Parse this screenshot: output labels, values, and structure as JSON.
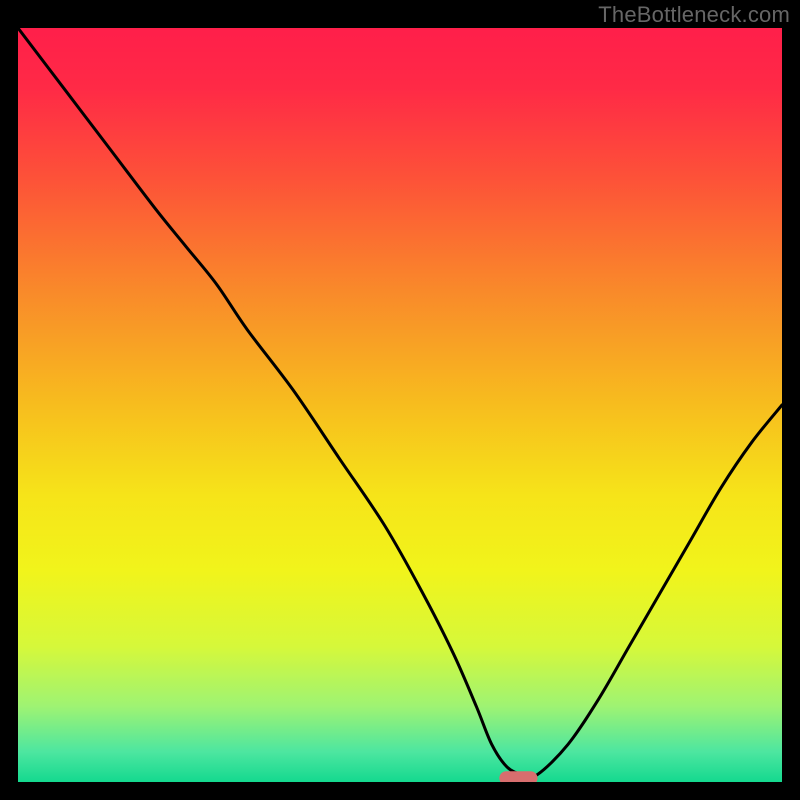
{
  "watermark": "TheBottleneck.com",
  "colors": {
    "frame": "#000000",
    "curve": "#000000",
    "marker_fill": "#d86e6e",
    "gradient_stops": [
      {
        "offset": 0.0,
        "color": "#ff1f4a"
      },
      {
        "offset": 0.08,
        "color": "#ff2a46"
      },
      {
        "offset": 0.2,
        "color": "#fd5238"
      },
      {
        "offset": 0.35,
        "color": "#f98a2a"
      },
      {
        "offset": 0.5,
        "color": "#f7bd1e"
      },
      {
        "offset": 0.62,
        "color": "#f6e419"
      },
      {
        "offset": 0.72,
        "color": "#f1f41b"
      },
      {
        "offset": 0.82,
        "color": "#d6f83a"
      },
      {
        "offset": 0.9,
        "color": "#9ef373"
      },
      {
        "offset": 0.96,
        "color": "#4de6a0"
      },
      {
        "offset": 1.0,
        "color": "#14d98f"
      }
    ]
  },
  "chart_data": {
    "type": "line",
    "title": "",
    "xlabel": "",
    "ylabel": "",
    "xlim": [
      0,
      100
    ],
    "ylim": [
      0,
      100
    ],
    "x": [
      0,
      6,
      12,
      18,
      22,
      26,
      30,
      36,
      42,
      48,
      53,
      57,
      60,
      62,
      64,
      66,
      68,
      72,
      76,
      80,
      84,
      88,
      92,
      96,
      100
    ],
    "values": [
      100,
      92,
      84,
      76,
      71,
      66,
      60,
      52,
      43,
      34,
      25,
      17,
      10,
      5,
      2,
      1,
      1,
      5,
      11,
      18,
      25,
      32,
      39,
      45,
      50
    ],
    "optimum": {
      "x_start": 63,
      "x_end": 68,
      "y": 0.5
    }
  }
}
